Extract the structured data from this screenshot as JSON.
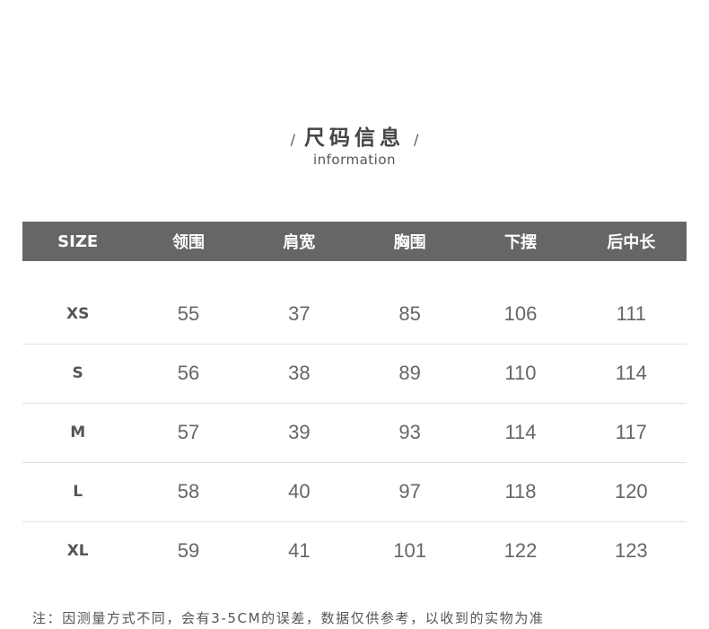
{
  "header": {
    "slash_left": "/",
    "title": "尺码信息",
    "slash_right": "/",
    "subtitle": "information"
  },
  "table": {
    "columns": [
      "SIZE",
      "领围",
      "肩宽",
      "胸围",
      "下摆",
      "后中长"
    ],
    "rows": [
      {
        "size": "XS",
        "values": [
          "55",
          "37",
          "85",
          "106",
          "111"
        ]
      },
      {
        "size": "S",
        "values": [
          "56",
          "38",
          "89",
          "110",
          "114"
        ]
      },
      {
        "size": "M",
        "values": [
          "57",
          "39",
          "93",
          "114",
          "117"
        ]
      },
      {
        "size": "L",
        "values": [
          "58",
          "40",
          "97",
          "118",
          "120"
        ]
      },
      {
        "size": "XL",
        "values": [
          "59",
          "41",
          "101",
          "122",
          "123"
        ]
      }
    ]
  },
  "note": "注：因测量方式不同，会有3-5CM的误差，数据仅供参考，以收到的实物为准",
  "colors": {
    "header_bg": "#666666",
    "header_text": "#ffffff",
    "row_divider": "#e2e2e2"
  }
}
